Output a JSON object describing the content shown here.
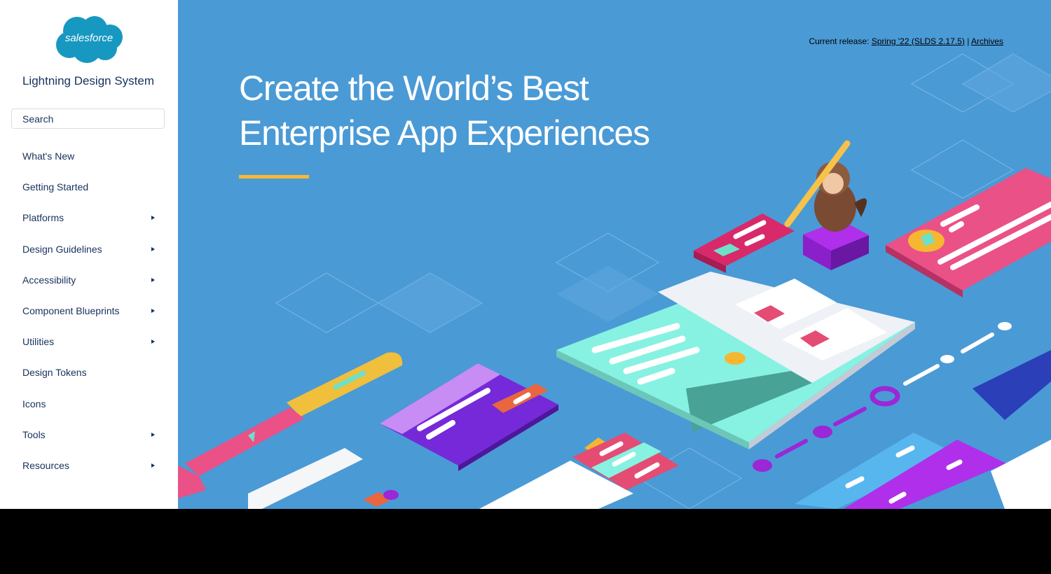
{
  "sidebar": {
    "logo_text": "salesforce",
    "title": "Lightning Design System",
    "search_placeholder": "Search",
    "items": [
      {
        "label": "What's New",
        "has_submenu": false
      },
      {
        "label": "Getting Started",
        "has_submenu": false
      },
      {
        "label": "Platforms",
        "has_submenu": true
      },
      {
        "label": "Design Guidelines",
        "has_submenu": true
      },
      {
        "label": "Accessibility",
        "has_submenu": true
      },
      {
        "label": "Component Blueprints",
        "has_submenu": true
      },
      {
        "label": "Utilities",
        "has_submenu": true
      },
      {
        "label": "Design Tokens",
        "has_submenu": false
      },
      {
        "label": "Icons",
        "has_submenu": false
      },
      {
        "label": "Tools",
        "has_submenu": true
      },
      {
        "label": "Resources",
        "has_submenu": true
      }
    ]
  },
  "hero": {
    "release_prefix": "Current release: ",
    "release_link": "Spring '22 (SLDS 2.17.5)",
    "separator": " | ",
    "archives_link": "Archives",
    "headline_line1": "Create the World’s Best",
    "headline_line2": "Enterprise App Experiences"
  },
  "colors": {
    "hero_bg": "#4a9ad6",
    "brand_blue": "#1798c1",
    "accent_yellow": "#ffb82e",
    "nav_text": "#16325c"
  },
  "icons": [
    "salesforce-cloud-logo",
    "chevron-right-icon"
  ]
}
